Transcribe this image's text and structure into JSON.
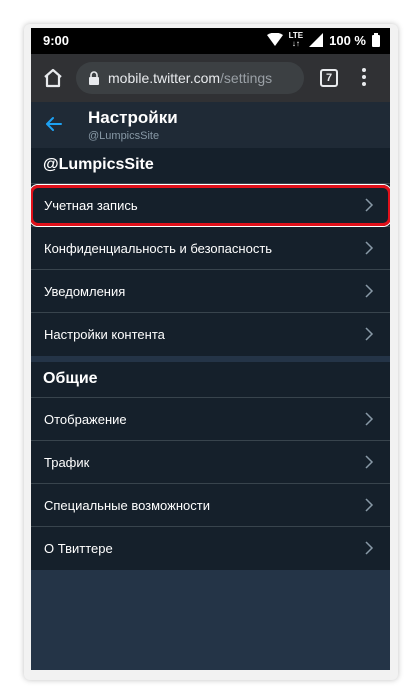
{
  "status_bar": {
    "time": "9:00",
    "network_label": "LTE",
    "battery_text": "100 %"
  },
  "browser": {
    "url_domain": "mobile.twitter.com",
    "url_path": "/settings",
    "tab_count": "7"
  },
  "header": {
    "title": "Настройки",
    "subtitle": "@LumpicsSite"
  },
  "sections": {
    "account": {
      "title": "@LumpicsSite",
      "items": [
        {
          "label": "Учетная запись"
        },
        {
          "label": "Конфиденциальность и безопасность"
        },
        {
          "label": "Уведомления"
        },
        {
          "label": "Настройки контента"
        }
      ]
    },
    "general": {
      "title": "Общие",
      "items": [
        {
          "label": "Отображение"
        },
        {
          "label": "Трафик"
        },
        {
          "label": "Специальные возможности"
        },
        {
          "label": "О Твиттере"
        }
      ]
    }
  },
  "colors": {
    "accent": "#1da1f2",
    "highlight": "#e0101a",
    "row_background": "#15202b",
    "page_background": "#243447"
  },
  "icons": {
    "home": "home-icon",
    "lock": "lock-icon",
    "back": "arrow-left-icon",
    "chevron": "chevron-right-icon",
    "menu": "more-vert-icon",
    "wifi": "wifi-icon",
    "signal": "signal-icon",
    "battery": "battery-icon"
  }
}
